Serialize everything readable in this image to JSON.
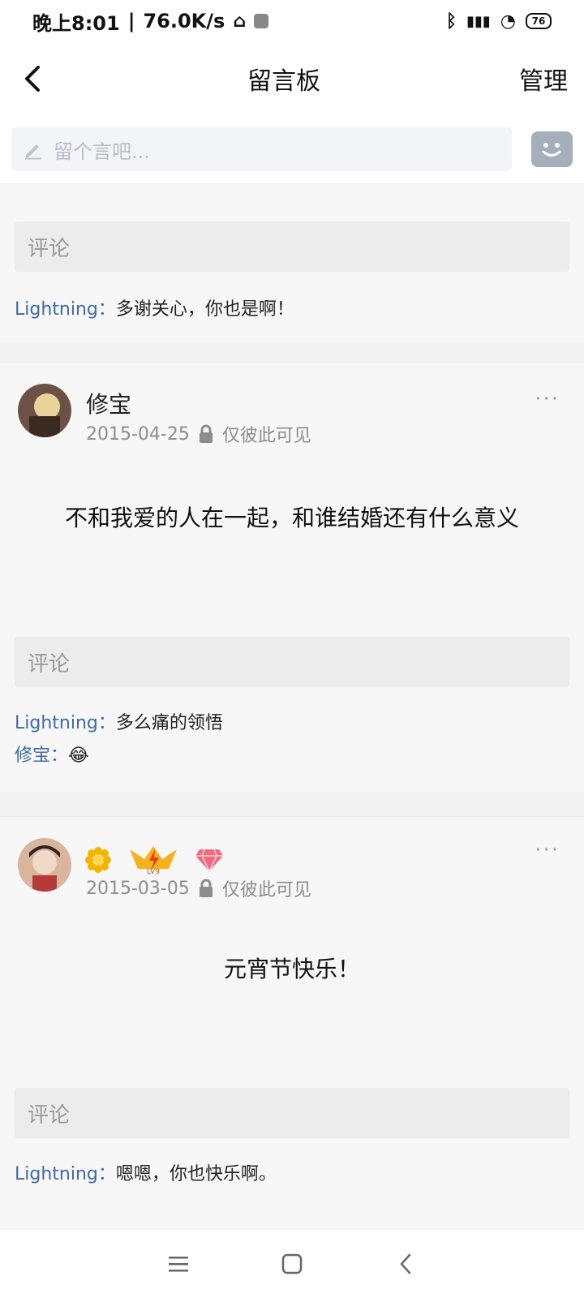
{
  "status_bar": {
    "time": "晚上8:01",
    "speed": "76.0K/s",
    "battery": "76"
  },
  "header": {
    "title": "留言板",
    "right_action": "管理",
    "back_icon": "chevron-left-icon"
  },
  "composer": {
    "placeholder": "留个言吧...",
    "icon": "pencil-icon",
    "emoji_icon": "smile-face-icon"
  },
  "cards": [
    {
      "comment_placeholder": "评论",
      "replies": [
        {
          "name": "Lightning",
          "sep": "：",
          "text": "多谢关心，你也是啊！"
        }
      ]
    },
    {
      "poster": "修宝",
      "date": "2015-04-25",
      "visibility": "仅彼此可见",
      "more": "···",
      "content": "不和我爱的人在一起，和谁结婚还有什么意义",
      "comment_placeholder": "评论",
      "replies": [
        {
          "name": "Lightning",
          "sep": "：",
          "text": "多么痛的领悟"
        },
        {
          "name": "修宝",
          "sep": "：",
          "text": "😂"
        }
      ]
    },
    {
      "poster": "",
      "badges": [
        "flower-icon",
        "level-crown-icon",
        "diamond-icon"
      ],
      "badge_level": "LV9",
      "date": "2015-03-05",
      "visibility": "仅彼此可见",
      "more": "···",
      "content": "元宵节快乐！",
      "comment_placeholder": "评论",
      "replies": [
        {
          "name": "Lightning",
          "sep": "：",
          "text": "嗯嗯，你也快乐啊。"
        }
      ]
    }
  ],
  "nav": {
    "menu_icon": "menu-icon",
    "home_icon": "home-square-icon",
    "back_icon": "back-triangle-icon"
  },
  "colors": {
    "link_blue": "#3f6aa6",
    "placeholder_gray": "#9a9a9a"
  }
}
